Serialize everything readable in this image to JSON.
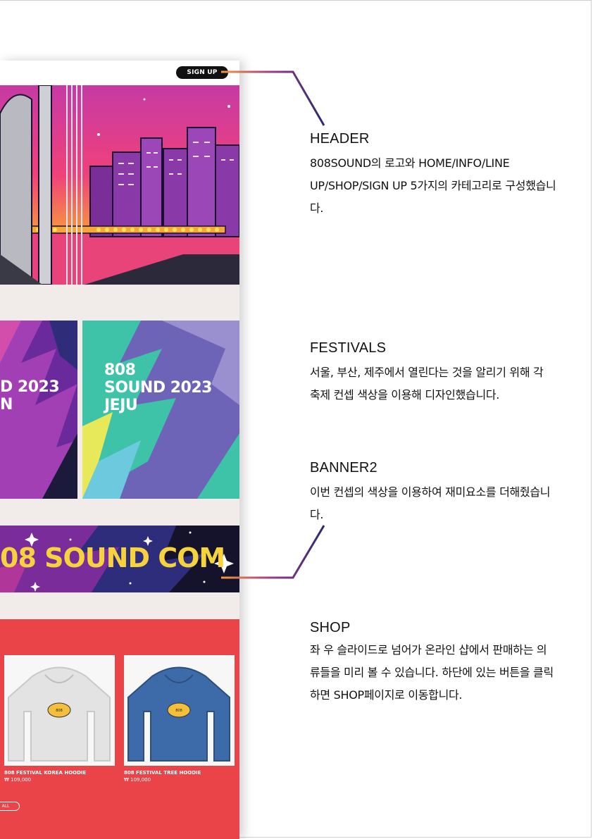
{
  "mock": {
    "signup_label": "SIGN UP",
    "festivals": {
      "left_title": [
        "D 2023",
        "N"
      ],
      "right_title": [
        "808",
        "SOUND 2023",
        "JEJU"
      ]
    },
    "banner2_text": "08 SOUND COM",
    "shop": {
      "products": [
        {
          "name": "808 FESTIVAL KOREA HOODIE",
          "price": "₩ 109,000",
          "color": "#e3e3e3"
        },
        {
          "name": "808 FESTIVAL TREE HOODIE",
          "price": "₩ 109,000",
          "color": "#3d6aa8"
        }
      ],
      "badge_text": "808 FESTIVAL 808",
      "all_button": "ALL"
    }
  },
  "annotations": [
    {
      "title": "HEADER",
      "body": "808SOUND의 로고와 HOME/INFO/LINE UP/SHOP/SIGN UP 5가지의 카테고리로 구성했습니다."
    },
    {
      "title": "FESTIVALS",
      "body": "서울, 부산, 제주에서 열린다는 것을 알리기 위해 각 축제 컨셉 색상을 이용해 디자인했습니다."
    },
    {
      "title": "BANNER2",
      "body": "이번 컨셉의 색상을 이용하여 재미요소를 더해줬습니다."
    },
    {
      "title": "SHOP",
      "body": "좌 우 슬라이드로 넘어가 온라인 샵에서 판매하는 의류들을 미리 볼 수 있습니다. 하단에 있는 버튼을 클릭하면 SHOP페이지로 이동합니다."
    }
  ],
  "colors": {
    "accent_line_start": "#f39a3b",
    "accent_line_end": "#2b2a6b",
    "shop_bg": "#ea4348",
    "banner_yellow": "#f6d33c"
  }
}
